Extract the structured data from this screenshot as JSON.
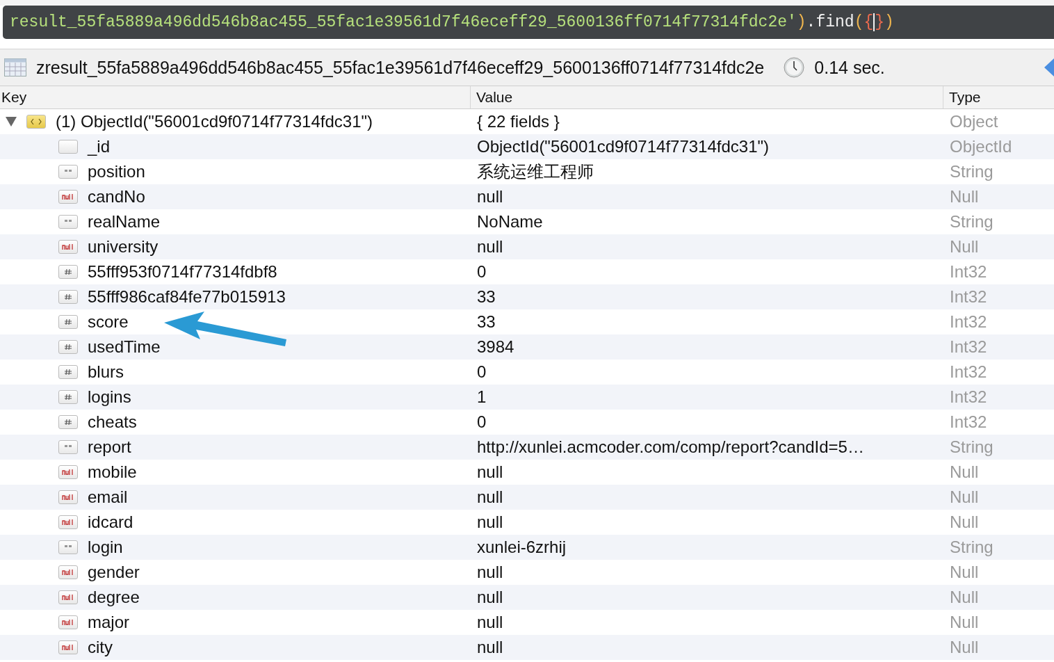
{
  "query": [
    {
      "kind": "string",
      "text": "result_55fa5889a496dd546b8ac455_55fac1e39561d7f46eceff29_5600136ff0714f77314fdc2e'"
    },
    {
      "kind": "paren",
      "text": ")"
    },
    {
      "kind": "method",
      "text": ".find"
    },
    {
      "kind": "paren",
      "text": "("
    },
    {
      "kind": "brace",
      "text": "{"
    },
    {
      "kind": "cursor"
    },
    {
      "kind": "brace",
      "text": "}"
    },
    {
      "kind": "paren",
      "text": ")"
    }
  ],
  "result_bar": {
    "collection": "zresult_55fa5889a496dd546b8ac455_55fac1e39561d7f46eceff29_5600136ff0714f77314fdc2e",
    "time": "0.14 sec."
  },
  "table": {
    "columns": [
      "Key",
      "Value",
      "Type"
    ],
    "root": {
      "key": "(1) ObjectId(\"56001cd9f0714f77314fdc31\")",
      "value": "{ 22 fields }",
      "type": "Object",
      "kind": "object",
      "expanded": true
    },
    "rows": [
      {
        "key": "_id",
        "value": "ObjectId(\"56001cd9f0714f77314fdc31\")",
        "type": "ObjectId",
        "kind": "objectid"
      },
      {
        "key": "position",
        "value": "系统运维工程师",
        "type": "String",
        "kind": "string"
      },
      {
        "key": "candNo",
        "value": "null",
        "type": "Null",
        "kind": "null"
      },
      {
        "key": "realName",
        "value": "NoName",
        "type": "String",
        "kind": "string"
      },
      {
        "key": "university",
        "value": "null",
        "type": "Null",
        "kind": "null"
      },
      {
        "key": "55fff953f0714f77314fdbf8",
        "value": "0",
        "type": "Int32",
        "kind": "int"
      },
      {
        "key": "55fff986caf84fe77b015913",
        "value": "33",
        "type": "Int32",
        "kind": "int"
      },
      {
        "key": "score",
        "value": "33",
        "type": "Int32",
        "kind": "int"
      },
      {
        "key": "usedTime",
        "value": "3984",
        "type": "Int32",
        "kind": "int"
      },
      {
        "key": "blurs",
        "value": "0",
        "type": "Int32",
        "kind": "int"
      },
      {
        "key": "logins",
        "value": "1",
        "type": "Int32",
        "kind": "int"
      },
      {
        "key": "cheats",
        "value": "0",
        "type": "Int32",
        "kind": "int"
      },
      {
        "key": "report",
        "value": "http://xunlei.acmcoder.com/comp/report?candId=5…",
        "type": "String",
        "kind": "string"
      },
      {
        "key": "mobile",
        "value": "null",
        "type": "Null",
        "kind": "null"
      },
      {
        "key": "email",
        "value": "null",
        "type": "Null",
        "kind": "null"
      },
      {
        "key": "idcard",
        "value": "null",
        "type": "Null",
        "kind": "null"
      },
      {
        "key": "login",
        "value": "xunlei-6zrhij",
        "type": "String",
        "kind": "string"
      },
      {
        "key": "gender",
        "value": "null",
        "type": "Null",
        "kind": "null"
      },
      {
        "key": "degree",
        "value": "null",
        "type": "Null",
        "kind": "null"
      },
      {
        "key": "major",
        "value": "null",
        "type": "Null",
        "kind": "null"
      },
      {
        "key": "city",
        "value": "null",
        "type": "Null",
        "kind": "null"
      }
    ]
  }
}
